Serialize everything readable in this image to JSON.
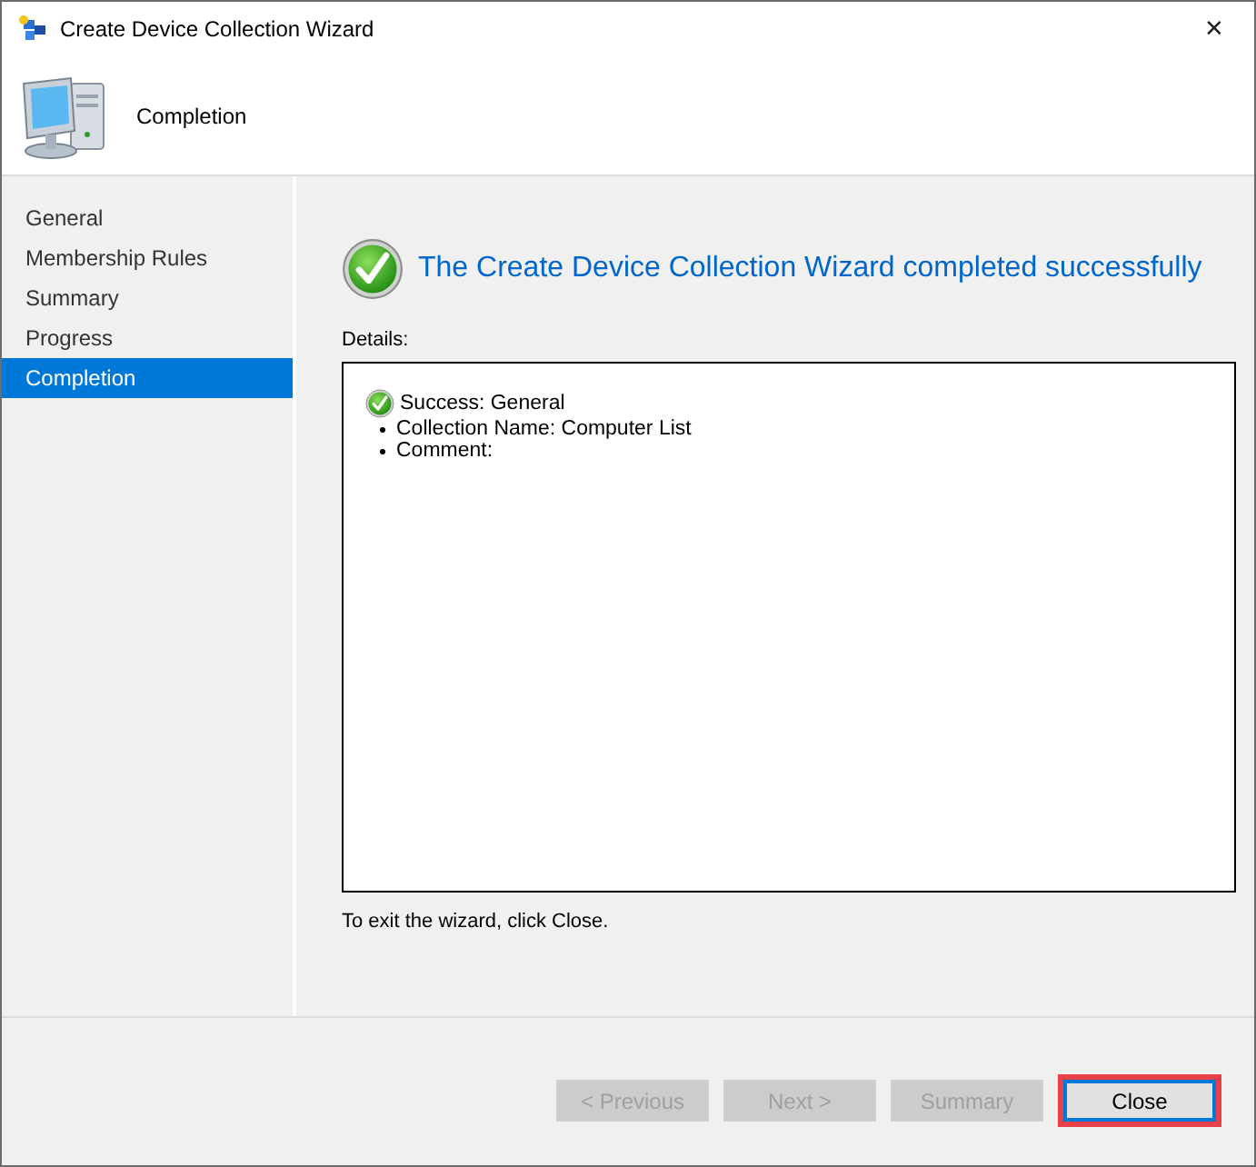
{
  "window": {
    "title": "Create Device Collection Wizard",
    "close": "✕"
  },
  "header": {
    "title": "Completion"
  },
  "sidebar": {
    "items": [
      {
        "label": "General",
        "selected": false
      },
      {
        "label": "Membership Rules",
        "selected": false
      },
      {
        "label": "Summary",
        "selected": false
      },
      {
        "label": "Progress",
        "selected": false
      },
      {
        "label": "Completion",
        "selected": true
      }
    ]
  },
  "content": {
    "heading": "The Create Device Collection Wizard completed successfully",
    "details_label": "Details:",
    "details": {
      "status": "Success: General",
      "bullets": [
        "Collection Name: Computer List",
        "Comment:"
      ]
    },
    "exit_hint": "To exit the wizard, click Close."
  },
  "buttons": [
    {
      "label": "< Previous",
      "disabled": true,
      "highlighted": false
    },
    {
      "label": "Next >",
      "disabled": true,
      "highlighted": false
    },
    {
      "label": "Summary",
      "disabled": true,
      "highlighted": false
    },
    {
      "label": "Close",
      "disabled": false,
      "highlighted": true
    }
  ]
}
